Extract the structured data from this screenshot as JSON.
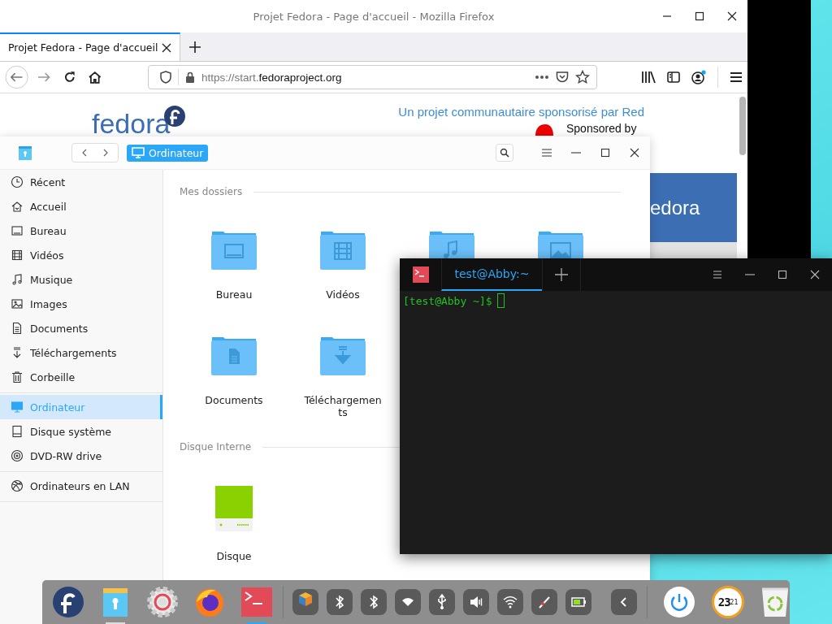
{
  "firefox": {
    "title": "Projet Fedora - Page d'accueil - Mozilla Firefox",
    "tabs": [
      {
        "label": "Projet Fedora - Page d'accueil",
        "selected": true
      }
    ],
    "url": {
      "prefix": "https://start.",
      "domain": "fedoraproject.org"
    },
    "page": {
      "logo": "fedora",
      "tagline": "Un projet communautaire sponsorisé par Red",
      "sponsor": "Sponsored by",
      "banner": "edora"
    }
  },
  "file_manager": {
    "location": "Ordinateur",
    "sidebar": [
      [
        {
          "label": "Récent",
          "kind": "clock",
          "selected": false
        },
        {
          "label": "Accueil",
          "kind": "home",
          "selected": false
        },
        {
          "label": "Bureau",
          "kind": "desktop",
          "selected": false
        },
        {
          "label": "Vidéos",
          "kind": "video",
          "selected": false
        },
        {
          "label": "Musique",
          "kind": "music",
          "selected": false
        },
        {
          "label": "Images",
          "kind": "image",
          "selected": false
        },
        {
          "label": "Documents",
          "kind": "document",
          "selected": false
        },
        {
          "label": "Téléchargements",
          "kind": "download",
          "selected": false
        },
        {
          "label": "Corbeille",
          "kind": "trash",
          "selected": false
        }
      ],
      [
        {
          "label": "Ordinateur",
          "kind": "computer",
          "selected": true
        },
        {
          "label": "Disque système",
          "kind": "disk",
          "selected": false
        },
        {
          "label": "DVD-RW drive",
          "kind": "dvd",
          "selected": false
        }
      ],
      [
        {
          "label": "Ordinateurs en LAN",
          "kind": "network",
          "selected": false
        }
      ]
    ],
    "sections": [
      {
        "title": "Mes dossiers",
        "items": [
          {
            "label": "Bureau",
            "kind": "desktop"
          },
          {
            "label": "Vidéos",
            "kind": "video"
          },
          {
            "kind": "music"
          },
          {
            "kind": "image"
          },
          {
            "label": "Documents",
            "kind": "document"
          },
          {
            "label": "Téléchargements",
            "kind": "download"
          }
        ]
      },
      {
        "title": "Disque Interne",
        "items": [
          {
            "label": "Disque",
            "kind": "drive"
          }
        ]
      }
    ]
  },
  "terminal": {
    "tabs": [
      {
        "label": "test@Abby:~",
        "selected": true
      }
    ],
    "prompt": "[test@Abby ~]$"
  },
  "taskbar": {
    "apps": [
      {
        "kind": "fedora",
        "running": false,
        "active": false
      },
      {
        "kind": "files",
        "running": true,
        "active": false
      },
      {
        "kind": "settings",
        "running": false,
        "active": false
      },
      {
        "kind": "firefox",
        "running": false,
        "active": false
      },
      {
        "kind": "terminal",
        "running": true,
        "active": true
      }
    ],
    "tray": [
      {
        "kind": "package"
      },
      {
        "kind": "bluetooth"
      },
      {
        "kind": "bluetooth"
      },
      {
        "kind": "network"
      },
      {
        "kind": "usb"
      },
      {
        "kind": "volume"
      },
      {
        "kind": "wifi"
      },
      {
        "kind": "pen"
      },
      {
        "kind": "battery"
      },
      {
        "kind": "collapse"
      }
    ],
    "clock": {
      "hour": "23",
      "minute": "21"
    }
  }
}
